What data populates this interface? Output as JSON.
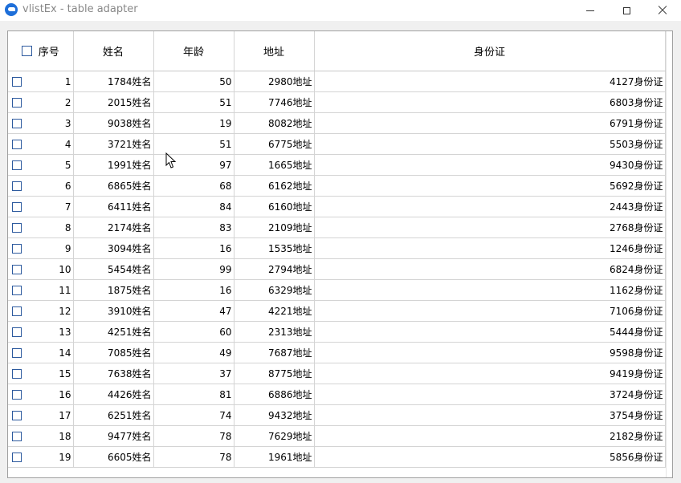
{
  "window": {
    "title": "vlistEx - table adapter"
  },
  "table": {
    "columns": [
      "序号",
      "姓名",
      "年龄",
      "地址",
      "身份证"
    ],
    "rows": [
      {
        "seq": "1",
        "name": "1784姓名",
        "age": "50",
        "addr": "2980地址",
        "id": "4127身份证"
      },
      {
        "seq": "2",
        "name": "2015姓名",
        "age": "51",
        "addr": "7746地址",
        "id": "6803身份证"
      },
      {
        "seq": "3",
        "name": "9038姓名",
        "age": "19",
        "addr": "8082地址",
        "id": "6791身份证"
      },
      {
        "seq": "4",
        "name": "3721姓名",
        "age": "51",
        "addr": "6775地址",
        "id": "5503身份证"
      },
      {
        "seq": "5",
        "name": "1991姓名",
        "age": "97",
        "addr": "1665地址",
        "id": "9430身份证"
      },
      {
        "seq": "6",
        "name": "6865姓名",
        "age": "68",
        "addr": "6162地址",
        "id": "5692身份证"
      },
      {
        "seq": "7",
        "name": "6411姓名",
        "age": "84",
        "addr": "6160地址",
        "id": "2443身份证"
      },
      {
        "seq": "8",
        "name": "2174姓名",
        "age": "83",
        "addr": "2109地址",
        "id": "2768身份证"
      },
      {
        "seq": "9",
        "name": "3094姓名",
        "age": "16",
        "addr": "1535地址",
        "id": "1246身份证"
      },
      {
        "seq": "10",
        "name": "5454姓名",
        "age": "99",
        "addr": "2794地址",
        "id": "6824身份证"
      },
      {
        "seq": "11",
        "name": "1875姓名",
        "age": "16",
        "addr": "6329地址",
        "id": "1162身份证"
      },
      {
        "seq": "12",
        "name": "3910姓名",
        "age": "47",
        "addr": "4221地址",
        "id": "7106身份证"
      },
      {
        "seq": "13",
        "name": "4251姓名",
        "age": "60",
        "addr": "2313地址",
        "id": "5444身份证"
      },
      {
        "seq": "14",
        "name": "7085姓名",
        "age": "49",
        "addr": "7687地址",
        "id": "9598身份证"
      },
      {
        "seq": "15",
        "name": "7638姓名",
        "age": "37",
        "addr": "8775地址",
        "id": "9419身份证"
      },
      {
        "seq": "16",
        "name": "4426姓名",
        "age": "81",
        "addr": "6886地址",
        "id": "3724身份证"
      },
      {
        "seq": "17",
        "name": "6251姓名",
        "age": "74",
        "addr": "9432地址",
        "id": "3754身份证"
      },
      {
        "seq": "18",
        "name": "9477姓名",
        "age": "78",
        "addr": "7629地址",
        "id": "2182身份证"
      },
      {
        "seq": "19",
        "name": "6605姓名",
        "age": "78",
        "addr": "1961地址",
        "id": "5856身份证"
      }
    ]
  },
  "colors": {
    "checkbox_border": "#2d5a9e",
    "grid_line": "#d4d4d4",
    "client_bg": "#f0f0f0"
  }
}
